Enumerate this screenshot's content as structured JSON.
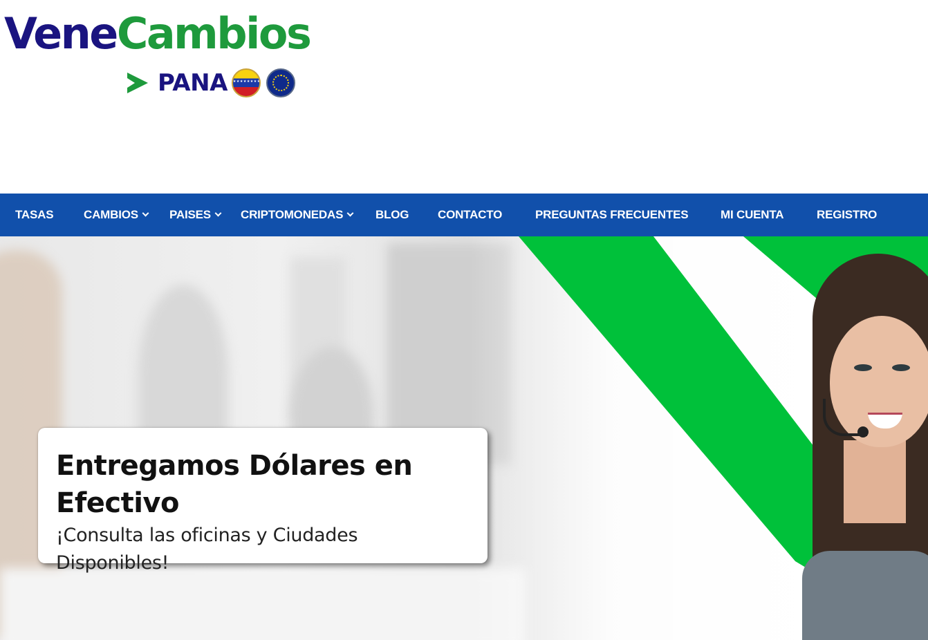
{
  "brand": {
    "name_part1": "Vene",
    "name_part2": "Cambios",
    "tagline": "PANA",
    "colors": {
      "navy": "#1a1480",
      "green": "#1e9a3c"
    },
    "flags": [
      "venezuela-flag-icon",
      "european-union-flag-icon"
    ]
  },
  "nav": {
    "background": "#1150ab",
    "items": [
      {
        "label": "TASAS",
        "dropdown": false
      },
      {
        "label": "CAMBIOS",
        "dropdown": true
      },
      {
        "label": "PAISES",
        "dropdown": true
      },
      {
        "label": "CRIPTOMONEDAS",
        "dropdown": true
      },
      {
        "label": "BLOG",
        "dropdown": false
      },
      {
        "label": "CONTACTO",
        "dropdown": false
      },
      {
        "label": "PREGUNTAS FRECUENTES",
        "dropdown": false
      },
      {
        "label": "MI CUENTA",
        "dropdown": false
      },
      {
        "label": "REGISTRO",
        "dropdown": false
      }
    ]
  },
  "hero": {
    "accent_green": "#00c13a",
    "card": {
      "title": "Entregamos Dólares en Efectivo",
      "subtitle": "¡Consulta las oficinas y Ciudades Disponibles!"
    }
  }
}
